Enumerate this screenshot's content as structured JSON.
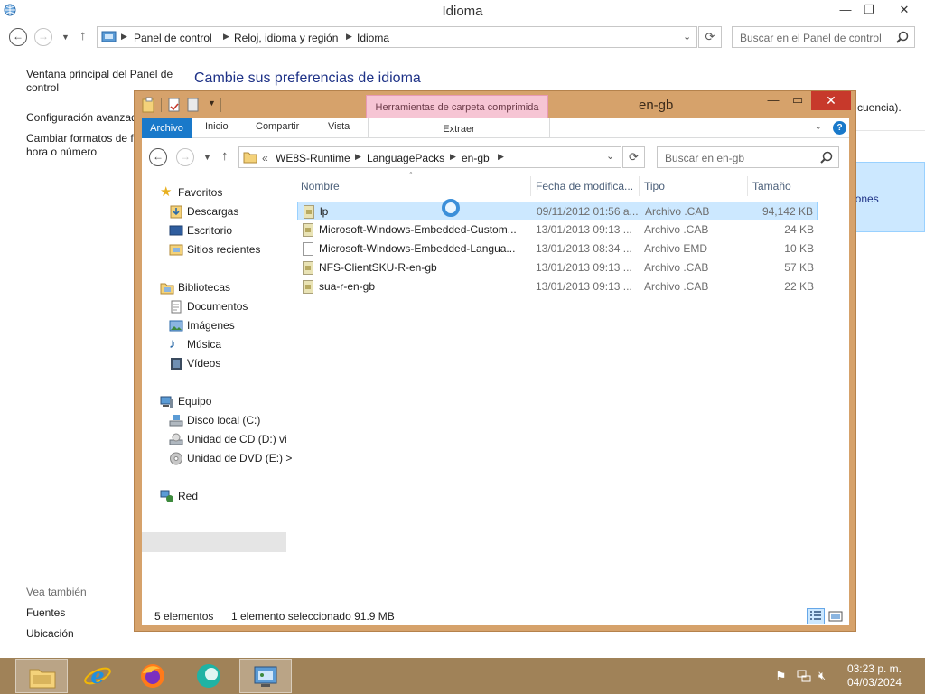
{
  "control_panel": {
    "title": "Idioma",
    "window_controls": {
      "minimize": "—",
      "maximize": "❐",
      "close": "✕"
    },
    "breadcrumb": [
      "Panel de control",
      "Reloj, idioma y región",
      "Idioma"
    ],
    "search_placeholder": "Buscar en el Panel de control",
    "left_links": {
      "home": "Ventana principal del Panel de control",
      "home_line1": "Ventana principal del Panel de",
      "home_line2": "control",
      "advanced": "Configuración avanzada",
      "formats_line1": "Cambiar formatos de fecha,",
      "formats_line2": "hora o número"
    },
    "see_also": {
      "heading": "Vea también",
      "fonts": "Fuentes",
      "location": "Ubicación"
    },
    "heading": "Cambie sus preferencias de idioma",
    "partial_text_right": "cuencia).",
    "partial_text_options": "iones"
  },
  "explorer": {
    "title": "en-gb",
    "contextual_tab": "Herramientas de carpeta comprimida",
    "ribbon_tabs": {
      "file": "Archivo",
      "home": "Inicio",
      "share": "Compartir",
      "view": "Vista",
      "extract": "Extraer"
    },
    "address": {
      "overflow": "«",
      "segments": [
        "WE8S-Runtime",
        "LanguagePacks",
        "en-gb"
      ]
    },
    "search_placeholder": "Buscar en en-gb",
    "nav": {
      "favorites": "Favoritos",
      "downloads": "Descargas",
      "desktop": "Escritorio",
      "recent": "Sitios recientes",
      "libraries": "Bibliotecas",
      "documents": "Documentos",
      "images": "Imágenes",
      "music": "Música",
      "videos": "Vídeos",
      "computer": "Equipo",
      "local_disk": "Disco local (C:)",
      "cd_drive": "Unidad de CD (D:) vi",
      "dvd_drive": "Unidad de DVD (E:) >",
      "network": "Red"
    },
    "columns": {
      "name": "Nombre",
      "date": "Fecha de modifica...",
      "type": "Tipo",
      "size": "Tamaño"
    },
    "files": [
      {
        "name": "lp",
        "date": "09/11/2012 01:56 a...",
        "type": "Archivo .CAB",
        "size": "94,142 KB",
        "icon": "cab-file-icon",
        "selected": true
      },
      {
        "name": "Microsoft-Windows-Embedded-Custom...",
        "date": "13/01/2013 09:13 ...",
        "type": "Archivo .CAB",
        "size": "24 KB",
        "icon": "cab-file-icon",
        "selected": false
      },
      {
        "name": "Microsoft-Windows-Embedded-Langua...",
        "date": "13/01/2013 08:34 ...",
        "type": "Archivo EMD",
        "size": "10 KB",
        "icon": "document-icon",
        "selected": false
      },
      {
        "name": "NFS-ClientSKU-R-en-gb",
        "date": "13/01/2013 09:13 ...",
        "type": "Archivo .CAB",
        "size": "57 KB",
        "icon": "cab-file-icon",
        "selected": false
      },
      {
        "name": "sua-r-en-gb",
        "date": "13/01/2013 09:13 ...",
        "type": "Archivo .CAB",
        "size": "22 KB",
        "icon": "cab-file-icon",
        "selected": false
      }
    ],
    "status": {
      "count": "5 elementos",
      "selection": "1 elemento seleccionado  91.9 MB"
    }
  },
  "taskbar": {
    "time": "03:23 p. m.",
    "date": "04/03/2024",
    "apps": [
      "file-explorer-icon",
      "internet-explorer-icon",
      "firefox-icon",
      "app-icon",
      "control-panel-icon"
    ]
  },
  "colors": {
    "explorer_frame": "#d6a26b",
    "taskbar": "#a08258",
    "selection": "#cce8ff",
    "accent": "#1979ca",
    "context_tab": "#f6c5d4"
  }
}
